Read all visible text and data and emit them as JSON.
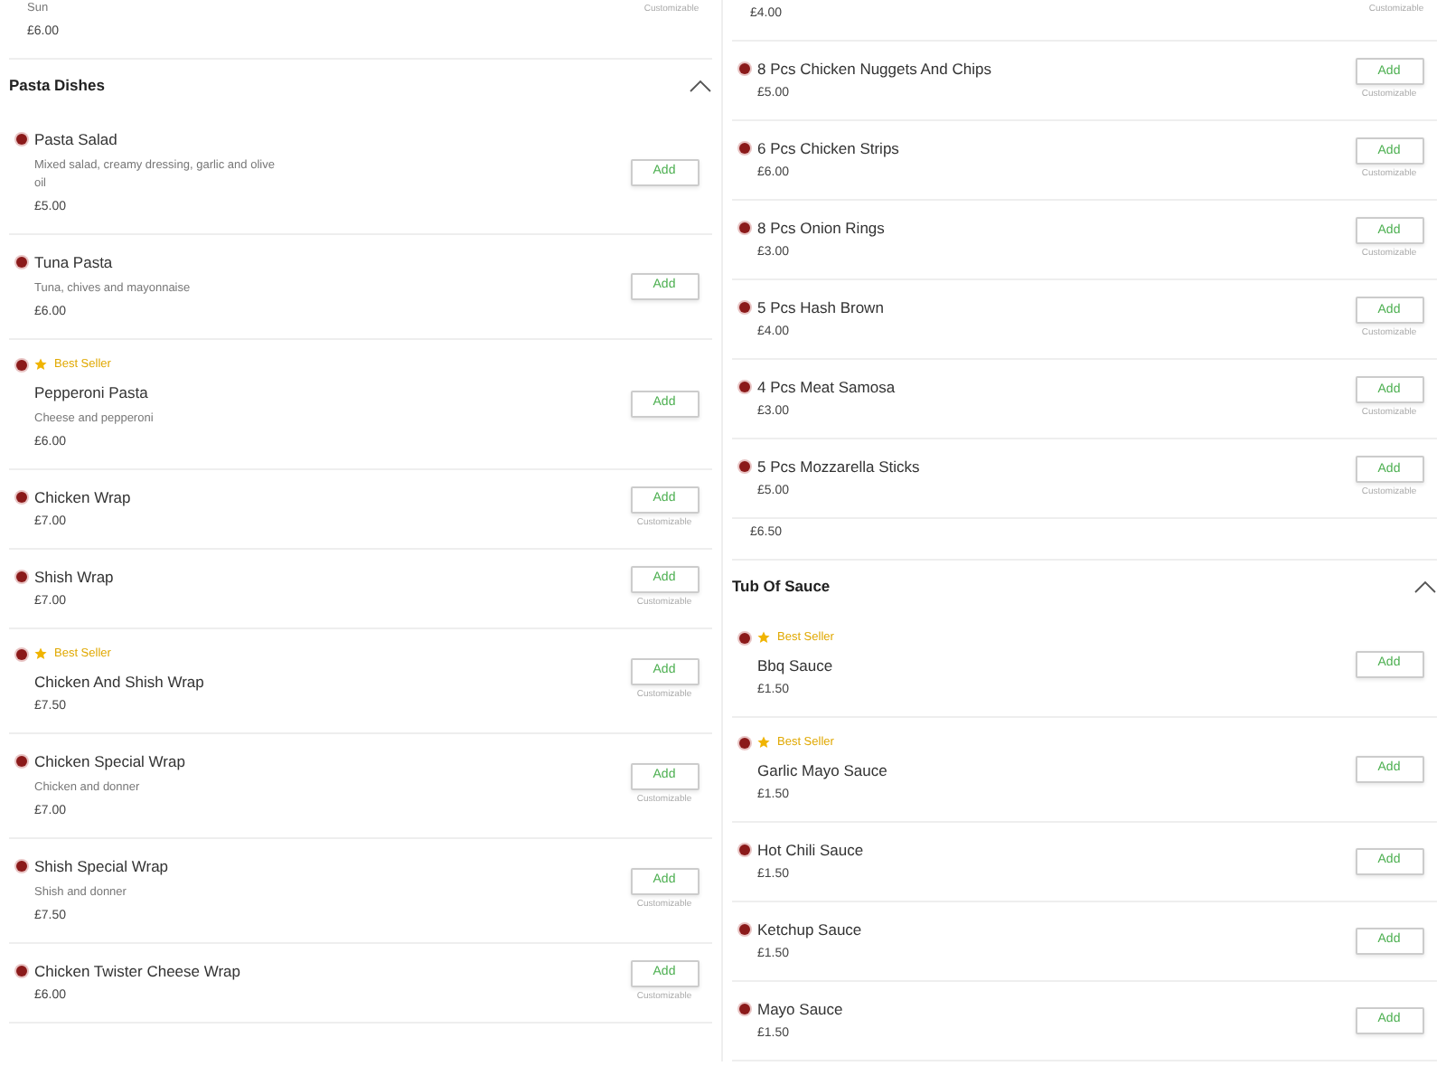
{
  "columns": [
    {
      "entries": [
        {
          "kind": "partial",
          "description": "Sun",
          "price": "£6.00",
          "note": "Customizable"
        },
        {
          "kind": "header",
          "title": "Pasta Dishes",
          "expanded": true
        },
        {
          "kind": "item",
          "best_seller": false,
          "name": "Pasta Salad",
          "description": "Mixed salad, creamy dressing, garlic and olive oil",
          "price": "£5.00",
          "button": "Add"
        },
        {
          "kind": "item",
          "best_seller": false,
          "name": "Tuna Pasta",
          "description": "Tuna, chives and mayonnaise",
          "price": "£6.00",
          "button": "Add"
        },
        {
          "kind": "item",
          "best_seller": true,
          "badge": "Best Seller",
          "name": "Pepperoni Pasta",
          "description": "Cheese and pepperoni",
          "price": "£6.00",
          "button": "Add"
        },
        {
          "kind": "item",
          "best_seller": false,
          "name": "Chicken Wrap",
          "price": "£7.00",
          "button": "Add",
          "note": "Customizable"
        },
        {
          "kind": "item",
          "best_seller": false,
          "name": "Shish Wrap",
          "price": "£7.00",
          "button": "Add",
          "note": "Customizable"
        },
        {
          "kind": "item",
          "best_seller": true,
          "badge": "Best Seller",
          "name": "Chicken And Shish Wrap",
          "price": "£7.50",
          "button": "Add",
          "note": "Customizable"
        },
        {
          "kind": "item",
          "best_seller": false,
          "name": "Chicken Special Wrap",
          "description": "Chicken and donner",
          "price": "£7.00",
          "button": "Add",
          "note": "Customizable"
        },
        {
          "kind": "item",
          "best_seller": false,
          "name": "Shish Special Wrap",
          "description": "Shish and donner",
          "price": "£7.50",
          "button": "Add",
          "note": "Customizable"
        },
        {
          "kind": "item",
          "best_seller": false,
          "name": "Chicken Twister Cheese Wrap",
          "price": "£6.00",
          "button": "Add",
          "note": "Customizable"
        }
      ]
    },
    {
      "entries": [
        {
          "kind": "partial",
          "price": "£4.00",
          "note": "Customizable"
        },
        {
          "kind": "item",
          "best_seller": false,
          "name": "8 Pcs Chicken Nuggets And Chips",
          "price": "£5.00",
          "button": "Add",
          "note": "Customizable"
        },
        {
          "kind": "item",
          "best_seller": false,
          "name": "6 Pcs Chicken Strips",
          "price": "£6.00",
          "button": "Add",
          "note": "Customizable"
        },
        {
          "kind": "item",
          "best_seller": false,
          "name": "8 Pcs Onion Rings",
          "price": "£3.00",
          "button": "Add",
          "note": "Customizable"
        },
        {
          "kind": "item",
          "best_seller": false,
          "name": "5 Pcs Hash Brown",
          "price": "£4.00",
          "button": "Add",
          "note": "Customizable"
        },
        {
          "kind": "item",
          "best_seller": false,
          "name": "4 Pcs Meat Samosa",
          "price": "£3.00",
          "button": "Add",
          "note": "Customizable"
        },
        {
          "kind": "item",
          "best_seller": false,
          "name": "5 Pcs Mozzarella Sticks",
          "price": "£5.00",
          "button": "Add",
          "note": "Customizable"
        },
        {
          "kind": "partial",
          "price": "£6.50"
        },
        {
          "kind": "header",
          "title": "Tub Of Sauce",
          "expanded": true
        },
        {
          "kind": "item",
          "best_seller": true,
          "badge": "Best Seller",
          "name": "Bbq Sauce",
          "price": "£1.50",
          "button": "Add"
        },
        {
          "kind": "item",
          "best_seller": true,
          "badge": "Best Seller",
          "name": "Garlic Mayo Sauce",
          "price": "£1.50",
          "button": "Add"
        },
        {
          "kind": "item",
          "best_seller": false,
          "name": "Hot Chili Sauce",
          "price": "£1.50",
          "button": "Add"
        },
        {
          "kind": "item",
          "best_seller": false,
          "name": "Ketchup Sauce",
          "price": "£1.50",
          "button": "Add"
        },
        {
          "kind": "item",
          "best_seller": false,
          "name": "Mayo Sauce",
          "price": "£1.50",
          "button": "Add"
        }
      ]
    }
  ]
}
